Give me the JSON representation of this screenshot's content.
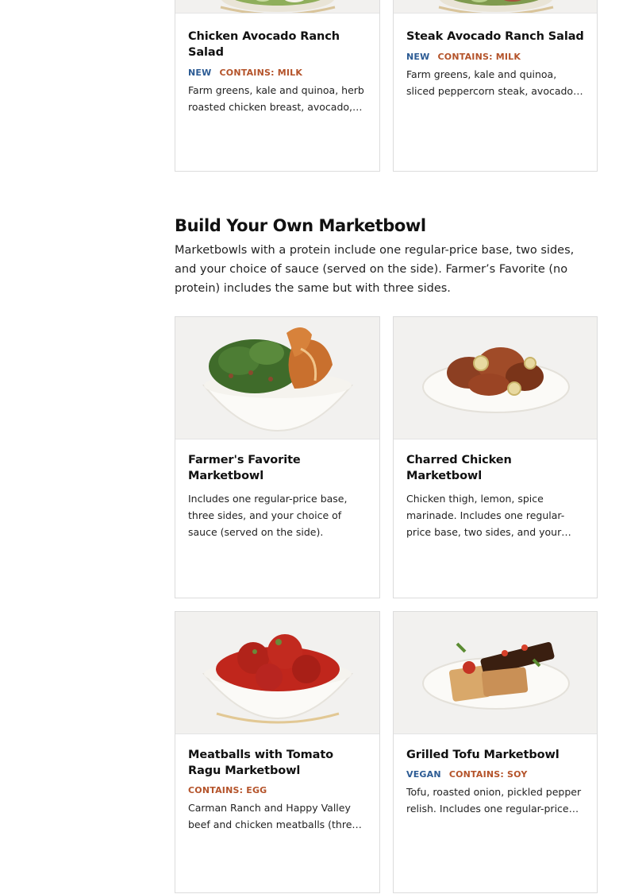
{
  "top_cards": [
    {
      "title": "Chicken Avocado Ranch Salad",
      "tag_new": "NEW",
      "tag_contains": "CONTAINS: MILK",
      "description": "Farm greens, kale and quinoa, herb roasted chicken breast, avocado, shaved parmesan, ranch dressing."
    },
    {
      "title": "Steak Avocado Ranch Salad",
      "tag_new": "NEW",
      "tag_contains": "CONTAINS: MILK",
      "description": "Farm greens, kale and quinoa, sliced peppercorn steak, avocado, sheet pan tomatoes, ranch dressing."
    }
  ],
  "section": {
    "title": "Build Your Own Marketbowl",
    "description": "Marketbowls with a protein include one regular-price base, two sides, and your choice of sauce (served on the side). Farmer’s Favorite (no protein) includes the same but with three sides."
  },
  "bowls": [
    {
      "title": "Farmer's Favorite Marketbowl",
      "description": "Includes one regular-price base, three sides, and your choice of sauce (served on the side).",
      "image_icon": "kale-sweet-potato-bowl-icon"
    },
    {
      "title": "Charred Chicken Marketbowl",
      "description": "Chicken thigh, lemon, spice marinade. Includes one regular-price base, two sides, and your choice of sauce (served on the side).",
      "image_icon": "charred-chicken-plate-icon"
    },
    {
      "title": "Meatballs with Tomato Ragu Marketbowl",
      "tag_contains": "CONTAINS: EGG",
      "description": "Carman Ranch and Happy Valley beef and chicken meatballs (three), tomato ragu. Includes one regular-price base, two sides, and your choice of sauce.",
      "image_icon": "meatballs-bowl-icon"
    },
    {
      "title": "Grilled Tofu Marketbowl",
      "tag_vegan": "VEGAN",
      "tag_contains": "CONTAINS: SOY",
      "description": "Tofu, roasted onion, pickled pepper relish. Includes one regular-price base, two sides, and your choice of sauce.",
      "image_icon": "grilled-tofu-plate-icon"
    }
  ],
  "colors": {
    "tag_new": "#2c5b94",
    "tag_contains": "#b4532a",
    "image_bg": "#f2f1ef",
    "border": "#dcdcdc"
  }
}
